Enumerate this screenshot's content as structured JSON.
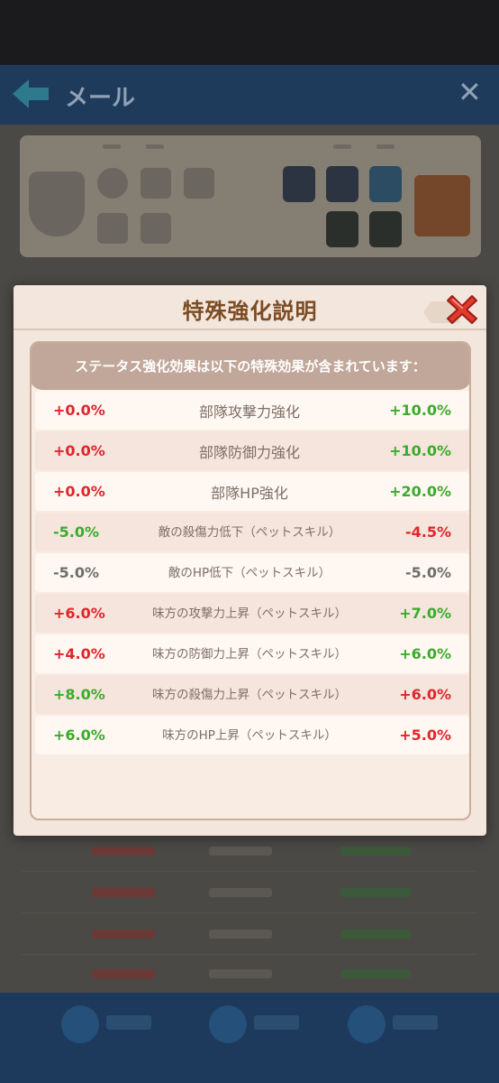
{
  "background": {
    "title": "メール",
    "colors": {
      "topbar": "#1f3b5c",
      "content": "#4b4945",
      "bottombar": "#1d3a5c"
    }
  },
  "dialog": {
    "title": "特殊強化説明",
    "banner": "ステータス強化効果は以下の特殊効果が含まれています：",
    "colors": {
      "positive": "#3cab2c",
      "negative": "#e0252b",
      "neutral": "#6e6e6e",
      "title": "#7d4c23"
    },
    "rows": [
      {
        "before": "+0.0%",
        "before_color": "negative",
        "name": "部隊攻撃力強化",
        "after": "+10.0%",
        "after_color": "positive"
      },
      {
        "before": "+0.0%",
        "before_color": "negative",
        "name": "部隊防御力強化",
        "after": "+10.0%",
        "after_color": "positive"
      },
      {
        "before": "+0.0%",
        "before_color": "negative",
        "name": "部隊HP強化",
        "after": "+20.0%",
        "after_color": "positive"
      },
      {
        "before": "-5.0%",
        "before_color": "positive",
        "name": "敵の殺傷力低下（ペットスキル）",
        "after": "-4.5%",
        "after_color": "negative"
      },
      {
        "before": "-5.0%",
        "before_color": "neutral",
        "name": "敵のHP低下（ペットスキル）",
        "after": "-5.0%",
        "after_color": "neutral"
      },
      {
        "before": "+6.0%",
        "before_color": "negative",
        "name": "味方の攻撃力上昇（ペットスキル）",
        "after": "+7.0%",
        "after_color": "positive"
      },
      {
        "before": "+4.0%",
        "before_color": "negative",
        "name": "味方の防御力上昇（ペットスキル）",
        "after": "+6.0%",
        "after_color": "positive"
      },
      {
        "before": "+8.0%",
        "before_color": "positive",
        "name": "味方の殺傷力上昇（ペットスキル）",
        "after": "+6.0%",
        "after_color": "negative"
      },
      {
        "before": "+6.0%",
        "before_color": "positive",
        "name": "味方のHP上昇（ペットスキル）",
        "after": "+5.0%",
        "after_color": "negative"
      }
    ]
  }
}
